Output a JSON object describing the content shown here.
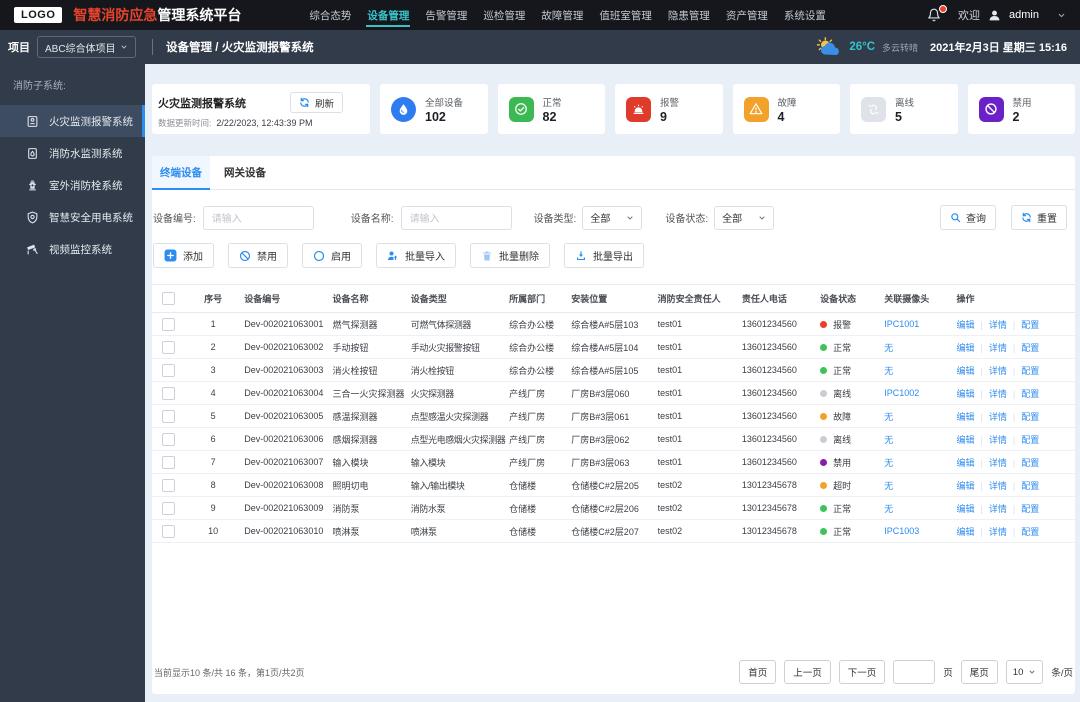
{
  "topbar": {
    "logo": "LOGO",
    "brand_red": "智慧消防应急",
    "brand_white": "管理系统平台",
    "nav": [
      {
        "label": "综合态势",
        "active": false
      },
      {
        "label": "设备管理",
        "active": true
      },
      {
        "label": "告警管理",
        "active": false
      },
      {
        "label": "巡检管理",
        "active": false
      },
      {
        "label": "故障管理",
        "active": false
      },
      {
        "label": "值班室管理",
        "active": false
      },
      {
        "label": "隐患管理",
        "active": false
      },
      {
        "label": "资产管理",
        "active": false
      },
      {
        "label": "系统设置",
        "active": false
      }
    ],
    "welcome": "欢迎",
    "username": "admin"
  },
  "subbar": {
    "project_label": "项目",
    "project_value": "ABC综合体项目",
    "breadcrumb": "设备管理 / 火灾监测报警系统",
    "temperature": "26°C",
    "weather": "多云转晴",
    "datetime": "2021年2月3日 星期三 15:16"
  },
  "sidebar": {
    "section_label": "消防子系统:",
    "items": [
      {
        "label": "火灾监测报警系统",
        "icon": "fire-alarm-icon",
        "active": true
      },
      {
        "label": "消防水监测系统",
        "icon": "water-monitor-icon",
        "active": false
      },
      {
        "label": "室外消防栓系统",
        "icon": "hydrant-icon",
        "active": false
      },
      {
        "label": "智慧安全用电系统",
        "icon": "shield-icon",
        "active": false
      },
      {
        "label": "视频监控系统",
        "icon": "camera-icon",
        "active": false
      }
    ]
  },
  "overview": {
    "title": "火灾监测报警系统",
    "refresh_label": "刷新",
    "update_label": "数据更新时间:",
    "update_time": "2/22/2023, 12:43:39 PM",
    "stats": [
      {
        "label": "全部设备",
        "value": "102",
        "icon": "drop-icon",
        "color": "#2e7cf0",
        "shape": "round"
      },
      {
        "label": "正常",
        "value": "82",
        "icon": "check-circle-icon",
        "color": "#3db954",
        "shape": "square"
      },
      {
        "label": "报警",
        "value": "9",
        "icon": "alarm-icon",
        "color": "#e03b2a",
        "shape": "square"
      },
      {
        "label": "故障",
        "value": "4",
        "icon": "warning-triangle-icon",
        "color": "#f2a129",
        "shape": "square"
      },
      {
        "label": "离线",
        "value": "5",
        "icon": "broken-link-icon",
        "color": "#dfe2e8",
        "shape": "square"
      },
      {
        "label": "禁用",
        "value": "2",
        "icon": "ban-icon",
        "color": "#6b21c8",
        "shape": "square"
      }
    ]
  },
  "tabs": [
    {
      "label": "终端设备",
      "active": true
    },
    {
      "label": "网关设备",
      "active": false
    }
  ],
  "filters": {
    "device_id_label": "设备编号:",
    "device_id_placeholder": "请输入",
    "device_name_label": "设备名称:",
    "device_name_placeholder": "请输入",
    "device_type_label": "设备类型:",
    "device_type_value": "全部",
    "device_status_label": "设备状态:",
    "device_status_value": "全部",
    "search_label": "查询",
    "reset_label": "重置"
  },
  "actions": [
    {
      "label": "添加",
      "icon": "plus-icon"
    },
    {
      "label": "禁用",
      "icon": "ban-outline-icon"
    },
    {
      "label": "启用",
      "icon": "circle-icon"
    },
    {
      "label": "批量导入",
      "icon": "import-icon"
    },
    {
      "label": "批量删除",
      "icon": "trash-icon"
    },
    {
      "label": "批量导出",
      "icon": "export-icon"
    }
  ],
  "table": {
    "columns": [
      "序号",
      "设备编号",
      "设备名称",
      "设备类型",
      "所属部门",
      "安装位置",
      "消防安全责任人",
      "责任人电话",
      "设备状态",
      "关联摄像头",
      "操作"
    ],
    "op_labels": [
      "编辑",
      "详情",
      "配置"
    ],
    "status_colors": {
      "报警": "#f03b2a",
      "正常": "#3fc257",
      "离线": "#c9ccd2",
      "故障": "#f2a129",
      "禁用": "#8a1cac",
      "超时": "#f2a129"
    },
    "rows": [
      {
        "num": "1",
        "id": "Dev-002021063001",
        "name": "燃气探测器",
        "type": "可燃气体探测器",
        "dept": "综合办公楼",
        "loc": "综合楼A#5层103",
        "person": "test01",
        "phone": "13601234560",
        "status": "报警",
        "camera": "IPC1001"
      },
      {
        "num": "2",
        "id": "Dev-002021063002",
        "name": "手动按钮",
        "type": "手动火灾报警按钮",
        "dept": "综合办公楼",
        "loc": "综合楼A#5层104",
        "person": "test01",
        "phone": "13601234560",
        "status": "正常",
        "camera": "无"
      },
      {
        "num": "3",
        "id": "Dev-002021063003",
        "name": "消火栓按钮",
        "type": "消火栓按钮",
        "dept": "综合办公楼",
        "loc": "综合楼A#5层105",
        "person": "test01",
        "phone": "13601234560",
        "status": "正常",
        "camera": "无"
      },
      {
        "num": "4",
        "id": "Dev-002021063004",
        "name": "三合一火灾探测器",
        "type": "火灾探测器",
        "dept": "产线厂房",
        "loc": "厂房B#3层060",
        "person": "test01",
        "phone": "13601234560",
        "status": "离线",
        "camera": "IPC1002"
      },
      {
        "num": "5",
        "id": "Dev-002021063005",
        "name": "感温探测器",
        "type": "点型感温火灾探测器",
        "dept": "产线厂房",
        "loc": "厂房B#3层061",
        "person": "test01",
        "phone": "13601234560",
        "status": "故障",
        "camera": "无"
      },
      {
        "num": "6",
        "id": "Dev-002021063006",
        "name": "感烟探测器",
        "type": "点型光电感烟火灾探测器",
        "dept": "产线厂房",
        "loc": "厂房B#3层062",
        "person": "test01",
        "phone": "13601234560",
        "status": "离线",
        "camera": "无"
      },
      {
        "num": "7",
        "id": "Dev-002021063007",
        "name": "输入模块",
        "type": "输入模块",
        "dept": "产线厂房",
        "loc": "厂房B#3层063",
        "person": "test01",
        "phone": "13601234560",
        "status": "禁用",
        "camera": "无"
      },
      {
        "num": "8",
        "id": "Dev-002021063008",
        "name": "照明切电",
        "type": "输入/输出模块",
        "dept": "仓储楼",
        "loc": "仓储楼C#2层205",
        "person": "test02",
        "phone": "13012345678",
        "status": "超时",
        "camera": "无"
      },
      {
        "num": "9",
        "id": "Dev-002021063009",
        "name": "消防泵",
        "type": "消防水泵",
        "dept": "仓储楼",
        "loc": "仓储楼C#2层206",
        "person": "test02",
        "phone": "13012345678",
        "status": "正常",
        "camera": "无"
      },
      {
        "num": "10",
        "id": "Dev-002021063010",
        "name": "喷淋泵",
        "type": "喷淋泵",
        "dept": "仓储楼",
        "loc": "仓储楼C#2层207",
        "person": "test02",
        "phone": "13012345678",
        "status": "正常",
        "camera": "IPC1003"
      }
    ]
  },
  "pagination": {
    "info": "当前显示10 条/共 16 条，第1页/共2页",
    "first": "首页",
    "prev": "上一页",
    "next": "下一页",
    "page_label": "页",
    "last": "尾页",
    "page_size": "10",
    "per_page_label": "条/页"
  }
}
